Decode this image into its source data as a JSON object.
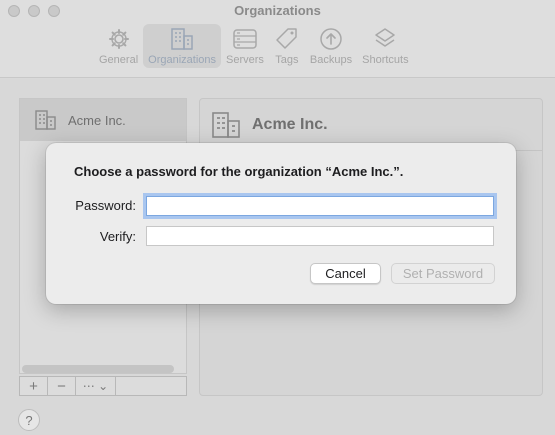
{
  "window": {
    "title": "Organizations"
  },
  "toolbar": {
    "items": [
      {
        "label": "General",
        "icon": "gear-icon",
        "selected": false
      },
      {
        "label": "Organizations",
        "icon": "building-icon",
        "selected": true
      },
      {
        "label": "Servers",
        "icon": "server-icon",
        "selected": false
      },
      {
        "label": "Tags",
        "icon": "tag-icon",
        "selected": false
      },
      {
        "label": "Backups",
        "icon": "upload-arrow-icon",
        "selected": false
      },
      {
        "label": "Shortcuts",
        "icon": "layers-icon",
        "selected": false
      }
    ]
  },
  "sidebar": {
    "items": [
      {
        "label": "Acme Inc.",
        "icon": "building-icon",
        "selected": true
      }
    ],
    "controls": {
      "add": "+",
      "remove": "−",
      "more": "⋯ ⌄"
    }
  },
  "detail": {
    "title": "Acme Inc."
  },
  "help": {
    "label": "?"
  },
  "dialog": {
    "message": "Choose a password for the organization “Acme Inc.”.",
    "password_label": "Password:",
    "password_value": "",
    "verify_label": "Verify:",
    "verify_value": "",
    "cancel_label": "Cancel",
    "submit_label": "Set Password"
  },
  "colors": {
    "focus_ring": "#a9c6ef",
    "selected_toolbar_text": "#9aa6b6"
  }
}
